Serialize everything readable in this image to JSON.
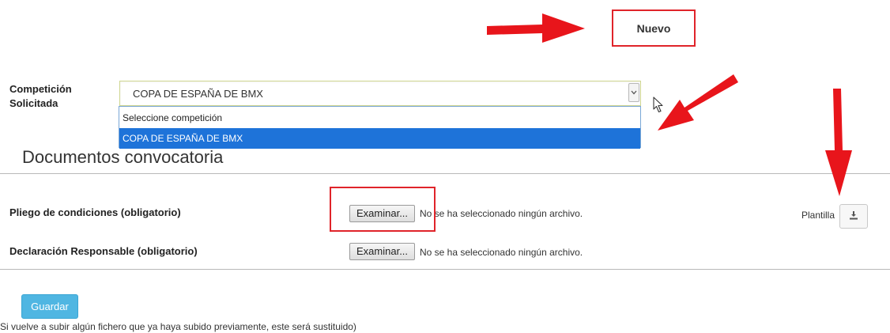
{
  "toolbar": {
    "new_label": "Nuevo"
  },
  "competition": {
    "label": "Competición Solicitada",
    "selected_value": "COPA DE ESPAÑA DE BMX",
    "options": [
      "Seleccione competición",
      "COPA DE ESPAÑA DE BMX"
    ]
  },
  "documents": {
    "title": "Documentos convocatoria",
    "rows": [
      {
        "label": "Pliego de condiciones (obligatorio)",
        "button_label": "Examinar...",
        "status": "No se ha seleccionado ningún archivo."
      },
      {
        "label": "Declaración Responsable (obligatorio)",
        "button_label": "Examinar...",
        "status": "No se ha seleccionado ningún archivo."
      }
    ],
    "template_label": "Plantilla"
  },
  "actions": {
    "save_label": "Guardar"
  },
  "footnote": "Si vuelve a subir algún fichero que ya haya subido previamente, este será sustituido)",
  "colors": {
    "annotation_red": "#e0242a",
    "primary_button": "#4fb6e2",
    "selected_option": "#1e73d9"
  },
  "icons": {
    "download": "download-icon",
    "dropdown": "chevron-down-icon",
    "cursor": "mouse-cursor-icon"
  }
}
